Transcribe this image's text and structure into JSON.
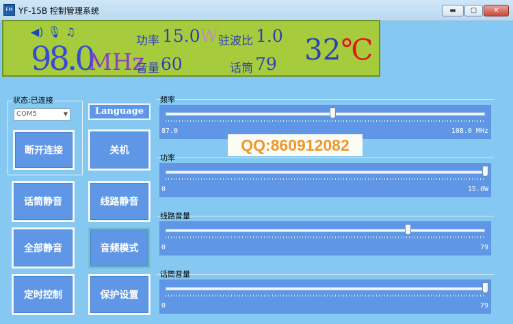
{
  "window": {
    "title": "YF-15B 控制管理系统",
    "icon_text": "FM",
    "min_label": "▬",
    "max_label": "▢",
    "close_label": "✕"
  },
  "display": {
    "icons": [
      "speaker-icon",
      "microphone-icon",
      "music-note-icon"
    ],
    "frequency": "98.0",
    "frequency_unit": "MHz",
    "power_label": "功率",
    "power_value": "15.0",
    "power_unit": "W",
    "vswr_label": "驻波比",
    "vswr_value": "1.0",
    "volume_label": "音量",
    "volume_value": "60",
    "mic_label": "话筒",
    "mic_value": "79",
    "temperature_value": "32",
    "temperature_unit": "℃"
  },
  "connection": {
    "status_label": "状态:已连接",
    "port_value": "COM5",
    "disconnect_label": "断开连接"
  },
  "buttons": {
    "language": "Language",
    "shutdown": "关机",
    "mic_mute": "话筒静音",
    "line_mute": "线路静音",
    "all_mute": "全部静音",
    "audio_mode": "音频模式",
    "timer": "定时控制",
    "protection": "保护设置"
  },
  "sliders": {
    "frequency": {
      "label": "频率",
      "min": "87.0",
      "max": "108.0 MHz",
      "value": 98.0,
      "range": [
        87.0,
        108.0
      ]
    },
    "power": {
      "label": "功率",
      "min": "0",
      "max": "15.0W",
      "value": 15.0,
      "range": [
        0,
        15.0
      ]
    },
    "line_volume": {
      "label": "线路音量",
      "min": "0",
      "max": "79",
      "value": 60,
      "range": [
        0,
        79
      ]
    },
    "mic_volume": {
      "label": "话筒音量",
      "min": "0",
      "max": "79",
      "value": 79,
      "range": [
        0,
        79
      ]
    }
  },
  "watermark": "QQ:860912082"
}
